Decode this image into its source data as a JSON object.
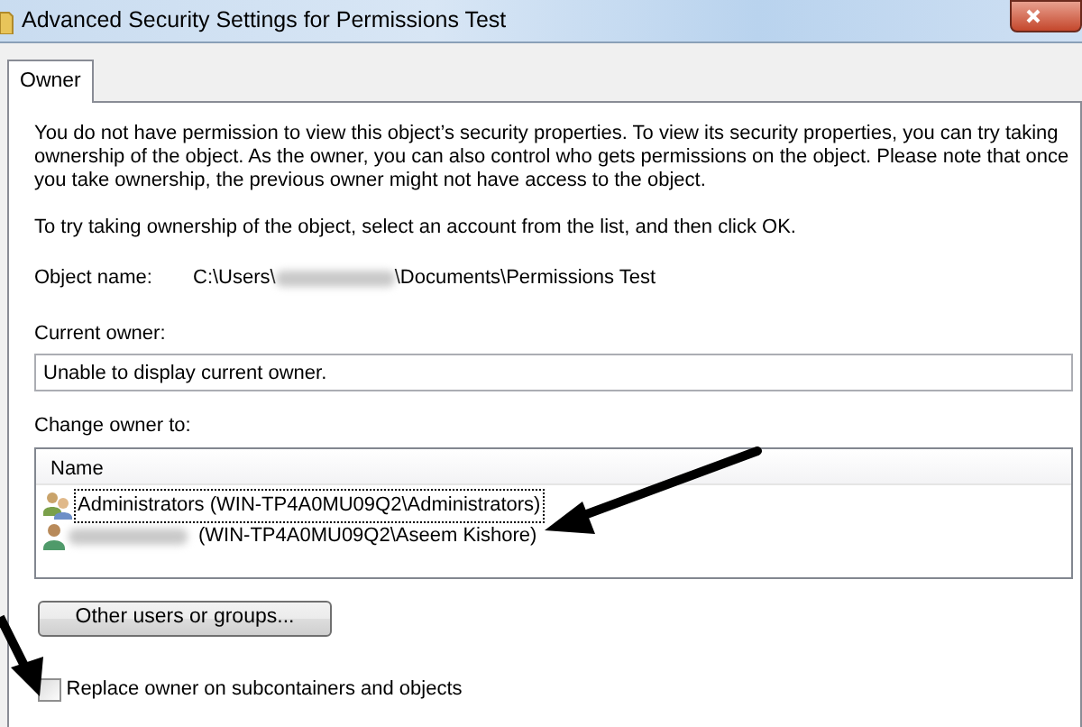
{
  "window": {
    "title": "Advanced Security Settings for Permissions Test"
  },
  "tabs": [
    {
      "label": "Owner",
      "selected": true
    }
  ],
  "intro": [
    "You do not have permission to view this object’s security properties. To view its security properties, you can try taking ownership of the object. As the owner, you can also control who gets permissions on the object. Please note that once you take ownership, the previous owner might not have access to the object.",
    "To try taking ownership of the object, select an account from the list, and then click OK."
  ],
  "object_name": {
    "label": "Object name:",
    "path_start": "C:\\Users\\",
    "path_end": "\\Documents\\Permissions Test"
  },
  "current_owner": {
    "label": "Current owner:",
    "value": "Unable to display current owner."
  },
  "change_owner": {
    "label": "Change owner to:",
    "columns": [
      "Name"
    ],
    "rows": [
      {
        "kind": "group",
        "name": "Administrators (WIN-TP4A0MU09Q2\\Administrators)",
        "selected": true
      },
      {
        "kind": "user",
        "name": "(WIN-TP4A0MU09Q2\\Aseem Kishore)",
        "selected": false
      }
    ]
  },
  "other_button": "Other users or groups...",
  "replace_checkbox": {
    "label": "Replace owner on subcontainers and objects",
    "checked": false
  }
}
